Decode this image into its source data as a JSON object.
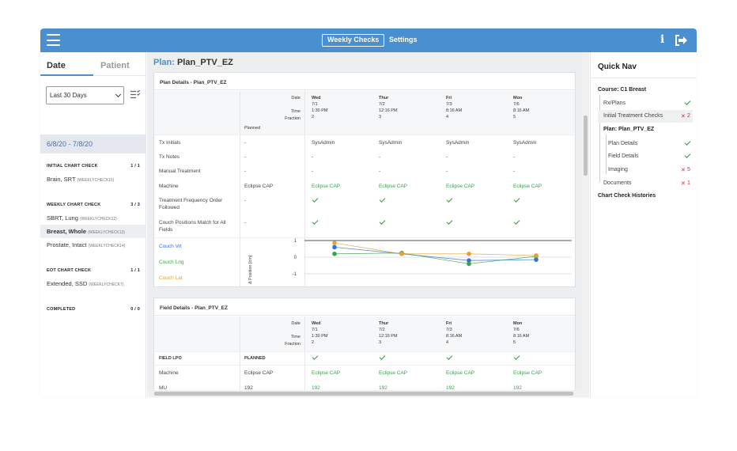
{
  "topbar": {
    "tab_weekly": "Weekly Checks",
    "tab_settings": "Settings",
    "info_glyph": "i"
  },
  "left": {
    "tab_date": "Date",
    "tab_patient": "Patient",
    "range_select": "Last 30 Days",
    "date_range": "6/8/20 - 7/8/20",
    "groups": [
      {
        "title": "INITIAL CHART CHECK",
        "count": "1 / 1",
        "items": [
          {
            "name": "Brain, SRT",
            "tag": "(WEEKLYCHECK15)"
          }
        ]
      },
      {
        "title": "WEEKLY CHART CHECK",
        "count": "3 / 3",
        "items": [
          {
            "name": "SBRT, Lung",
            "tag": "(WEEKLYCHECK12)"
          },
          {
            "name": "Breast, Whole",
            "tag": "(WEEKLYCHECK13)"
          },
          {
            "name": "Prostate, Intact",
            "tag": "(WEEKLYCHECK14)"
          }
        ]
      },
      {
        "title": "EOT CHART CHECK",
        "count": "1 / 1",
        "items": [
          {
            "name": "Extended, SSD",
            "tag": "(WEEKLYCHECK7)"
          }
        ]
      },
      {
        "title": "COMPLETED",
        "count": "0 / 0",
        "items": []
      }
    ]
  },
  "main": {
    "plan_label": "Plan:",
    "plan_name": "Plan_PTV_EZ",
    "plan_details": {
      "title": "Plan Details - Plan_PTV_EZ",
      "hdr_labels": {
        "date": "Date",
        "time": "Time",
        "fraction": "Fraction",
        "planned": "Planned"
      },
      "columns": [
        {
          "day": "Wed",
          "date": "7/1",
          "time": "1:30 PM",
          "fraction": "2"
        },
        {
          "day": "Thur",
          "date": "7/2",
          "time": "12:16 PM",
          "fraction": "3"
        },
        {
          "day": "Fri",
          "date": "7/3",
          "time": "8:16 AM",
          "fraction": "4"
        },
        {
          "day": "Mon",
          "date": "7/6",
          "time": "8:16 AM",
          "fraction": "5"
        }
      ],
      "rows": {
        "tx_initials": {
          "label": "Tx Initials",
          "planned": "-",
          "values": [
            "SysAdmin",
            "SysAdmin",
            "SysAdmin",
            "SysAdmin"
          ]
        },
        "tx_notes": {
          "label": "Tx Notes",
          "planned": "-",
          "values": [
            "-",
            "-",
            "-",
            "-"
          ]
        },
        "manual": {
          "label": "Manual Treatment",
          "planned": "-",
          "values": [
            "-",
            "-",
            "-",
            "-"
          ]
        },
        "machine": {
          "label": "Machine",
          "planned": "Eclipse CAP",
          "values": [
            "Eclipse CAP",
            "Eclipse CAP",
            "Eclipse CAP",
            "Eclipse CAP"
          ]
        },
        "freq": {
          "label": "Treatment Frequency Order Followed",
          "planned": "-"
        },
        "couch_match": {
          "label": "Couch Positions Match for All Fields",
          "planned": "-"
        }
      },
      "couch_legend": [
        "Couch Vrt",
        "Couch Lng",
        "Couch Lat"
      ]
    },
    "field_details": {
      "title": "Field Details - Plan_PTV_EZ",
      "hdr_labels": {
        "date": "Date",
        "time": "Time",
        "fraction": "Fraction"
      },
      "field_label": "FIELD LPO",
      "planned_label": "PLANNED",
      "machine": {
        "label": "Machine",
        "planned": "Eclipse CAP",
        "values": [
          "Eclipse CAP",
          "Eclipse CAP",
          "Eclipse CAP",
          "Eclipse CAP"
        ]
      },
      "mu": {
        "label": "MU",
        "planned": "192",
        "values": [
          "192",
          "192",
          "192",
          "192"
        ]
      }
    }
  },
  "chart_data": {
    "type": "line",
    "x": [
      "7/1",
      "7/2",
      "7/3",
      "7/6"
    ],
    "ylabel": "Δ Position [cm]",
    "yticks": [
      "1",
      "0",
      "-1"
    ],
    "ylim": [
      -1,
      1
    ],
    "series": [
      {
        "name": "Couch Vrt",
        "color": "#3b6fd4",
        "values": [
          0.6,
          0.2,
          -0.2,
          -0.15
        ]
      },
      {
        "name": "Couch Lng",
        "color": "#3aa14a",
        "values": [
          0.2,
          0.25,
          -0.4,
          0.05
        ]
      },
      {
        "name": "Couch Lat",
        "color": "#e0a23a",
        "values": [
          0.85,
          0.2,
          0.2,
          0.1
        ]
      }
    ]
  },
  "quick_nav": {
    "title": "Quick Nav",
    "course": "Course: C1 Breast",
    "rx": "Rx/Plans",
    "itc": "Initial Treatment Checks",
    "itc_count": "2",
    "plan": "Plan: Plan_PTV_EZ",
    "plan_details": "Plan Details",
    "field_details": "Field Details",
    "imaging": "Imaging",
    "imaging_count": "5",
    "documents": "Documents",
    "documents_count": "1",
    "histories": "Chart Check Histories"
  },
  "colors": {
    "brand": "#4a90d0",
    "success": "#3aa14a",
    "error": "#d9262a"
  }
}
